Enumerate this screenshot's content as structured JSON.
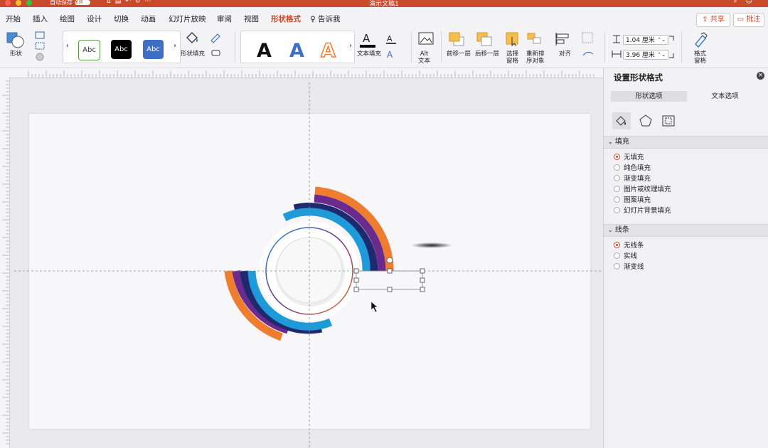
{
  "titlebar": {
    "autosave": "自动保存",
    "autosave_state": "关闭",
    "doc_title": "演示文稿1",
    "icons": [
      "home-icon",
      "save-icon",
      "undo-icon",
      "redo-icon",
      "more-icon"
    ]
  },
  "tabs": [
    "开始",
    "插入",
    "绘图",
    "设计",
    "切换",
    "动画",
    "幻灯片放映",
    "审阅",
    "视图",
    "形状格式",
    "告诉我"
  ],
  "active_tab": "形状格式",
  "top_buttons": {
    "share": "共享",
    "comments": "批注"
  },
  "ribbon": {
    "shape_label": "形状",
    "style_swatches": [
      "Abc",
      "Abc",
      "Abc"
    ],
    "shape_fill_label": "形状填充",
    "wordart": [
      "A",
      "A",
      "A"
    ],
    "text_fill_label": "文本填充",
    "alt_text_label": "Alt\n文本",
    "bring_forward": "前移一层",
    "send_backward": "后移一层",
    "selection_pane": "选择\n窗格",
    "reorder_objects": "重新排\n序对象",
    "align": "对齐",
    "height": "1.04 厘米",
    "width": "3.96 厘米",
    "format_pane": "格式\n窗格"
  },
  "colors": {
    "accent": "#c9492b",
    "orange": "#ee7d2f",
    "purple": "#6a2a8e",
    "navy": "#1f2a6e",
    "blue": "#1e9ad8"
  },
  "panel": {
    "title": "设置形状格式",
    "tabs": [
      "形状选项",
      "文本选项"
    ],
    "fill_section": "填充",
    "fill_options": [
      "无填充",
      "纯色填充",
      "渐变填充",
      "图片或纹理填充",
      "图案填充",
      "幻灯片背景填充"
    ],
    "line_section": "线条",
    "line_options": [
      "无线条",
      "实线",
      "渐变线"
    ]
  }
}
